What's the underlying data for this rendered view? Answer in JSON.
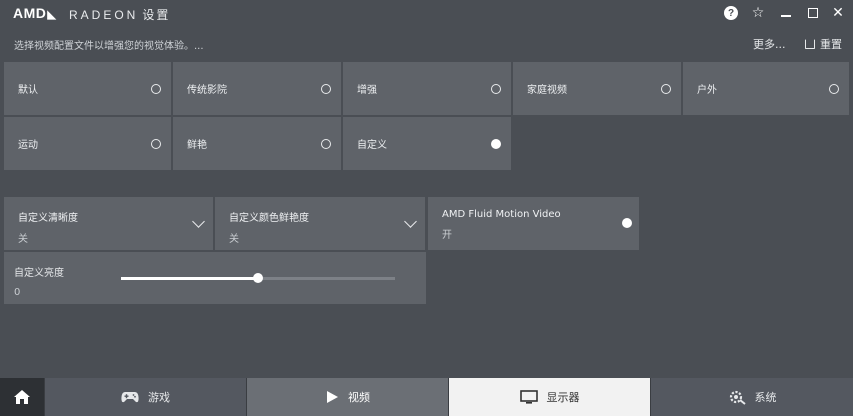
{
  "titlebar": {
    "logo": "AMD",
    "brand": "RADEON",
    "brand_setting": "设置",
    "help_icon": "?"
  },
  "header": {
    "subtitle": "选择视频配置文件以增强您的视觉体验。...",
    "more_label": "更多...",
    "reset_label": "重置"
  },
  "profiles": [
    {
      "label": "默认",
      "selected": false
    },
    {
      "label": "传统影院",
      "selected": false
    },
    {
      "label": "增强",
      "selected": false
    },
    {
      "label": "家庭视频",
      "selected": false
    },
    {
      "label": "户外",
      "selected": false
    },
    {
      "label": "运动",
      "selected": false
    },
    {
      "label": "鲜艳",
      "selected": false
    },
    {
      "label": "自定义",
      "selected": true
    }
  ],
  "settings": {
    "sharpness": {
      "label": "自定义清晰度",
      "value": "关"
    },
    "vividness": {
      "label": "自定义颜色鲜艳度",
      "value": "关"
    },
    "fluid_motion": {
      "label": "AMD Fluid Motion Video",
      "value": "开",
      "enabled": true
    },
    "brightness": {
      "label": "自定义亮度",
      "value": "0",
      "slider_fraction": 0.5
    }
  },
  "tabs": {
    "home_icon": "home-icon",
    "game": "游戏",
    "video": "视频",
    "display": "显示器",
    "system": "系统",
    "active": "video"
  }
}
